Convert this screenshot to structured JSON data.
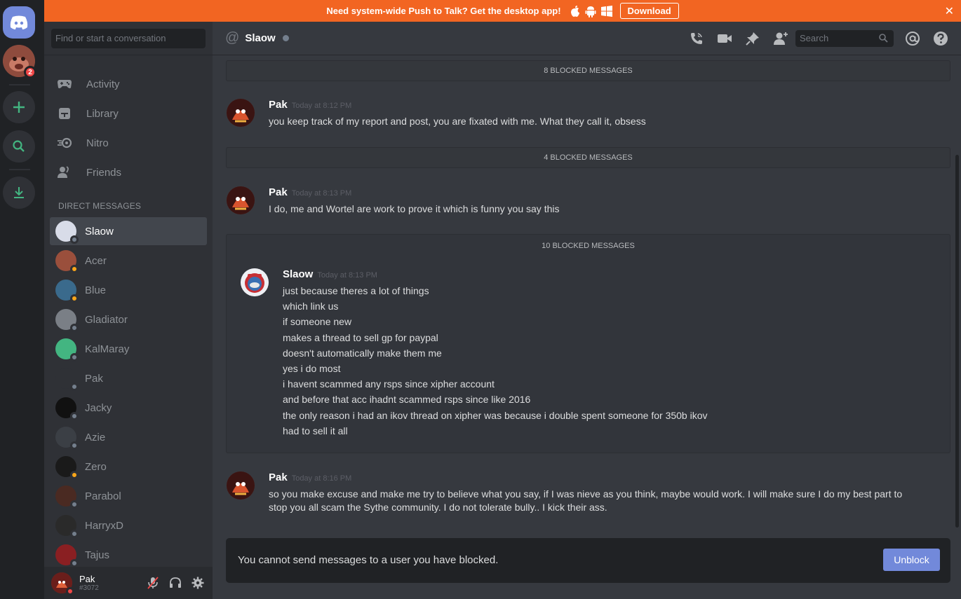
{
  "banner": {
    "text": "Need system-wide Push to Talk? Get the desktop app!",
    "download_label": "Download",
    "os_icons": [
      "apple-icon",
      "android-icon",
      "windows-icon"
    ]
  },
  "rail": {
    "notification_count": "2"
  },
  "sidebar": {
    "search_placeholder": "Find or start a conversation",
    "nav": [
      {
        "label": "Activity",
        "icon": "gamepad-icon"
      },
      {
        "label": "Library",
        "icon": "library-icon"
      },
      {
        "label": "Nitro",
        "icon": "nitro-icon"
      },
      {
        "label": "Friends",
        "icon": "friends-icon"
      }
    ],
    "dm_header": "DIRECT MESSAGES",
    "dms": [
      {
        "name": "Slaow",
        "status": "offline",
        "color": "#d8dce8",
        "active": true
      },
      {
        "name": "Acer",
        "status": "idle",
        "color": "#9a4f3c"
      },
      {
        "name": "Blue",
        "status": "idle",
        "color": "#3a6a8c"
      },
      {
        "name": "Gladiator",
        "status": "offline",
        "color": "#7a7f86"
      },
      {
        "name": "KalMaray",
        "status": "offline",
        "color": "#43b581"
      },
      {
        "name": "Pak",
        "status": "offline",
        "color": "#2f3136"
      },
      {
        "name": "Jacky",
        "status": "offline",
        "color": "#111111"
      },
      {
        "name": "Azie",
        "status": "offline",
        "color": "#3b3f45"
      },
      {
        "name": "Zero",
        "status": "idle",
        "color": "#1a1a1a"
      },
      {
        "name": "Parabol",
        "status": "offline",
        "color": "#4a2a22"
      },
      {
        "name": "HarryxD",
        "status": "offline",
        "color": "#2a2a2a"
      },
      {
        "name": "Tajus",
        "status": "offline",
        "color": "#8a1f22"
      }
    ]
  },
  "user": {
    "name": "Pak",
    "tag": "#3072"
  },
  "chat": {
    "channel_name": "Slaow",
    "search_placeholder": "Search",
    "blocked_bars": [
      "8 BLOCKED MESSAGES",
      "4 BLOCKED MESSAGES"
    ],
    "blocked_group_label": "10 BLOCKED MESSAGES",
    "messages": [
      {
        "author": "Pak",
        "time": "Today at 8:12 PM",
        "lines": [
          "you keep track of my report and post, you are fixated with me. What they call it, obsess"
        ]
      },
      {
        "author": "Pak",
        "time": "Today at 8:13 PM",
        "lines": [
          "I do, me and Wortel are work to prove it which is funny you say this"
        ]
      },
      {
        "author": "Slaow",
        "time": "Today at 8:13 PM",
        "lines": [
          "just because theres a lot of things",
          "which link us",
          "if someone new",
          "makes a thread to sell gp for paypal",
          "doesn't automatically make them me",
          "yes i do most",
          "i havent scammed any rsps since xipher account",
          "and before that acc ihadnt scammed rsps since like 2016",
          "the only reason i had an ikov thread on xipher was because i double spent someone for 350b ikov",
          "had to sell it all"
        ]
      },
      {
        "author": "Pak",
        "time": "Today at 8:16 PM",
        "lines": [
          "so you make excuse and make me try to believe what you say, if I was nieve as you think, maybe would work. I will make sure I do my best part to stop you all scam the Sythe community. I do not tolerate bully.. I kick their ass."
        ]
      }
    ],
    "composer_text": "You cannot send messages to a user you have blocked.",
    "unblock_label": "Unblock"
  },
  "colors": {
    "banner": "#f26522",
    "accent": "#7289da",
    "online_green": "#43b581",
    "idle": "#faa61a",
    "dnd": "#f04747"
  }
}
